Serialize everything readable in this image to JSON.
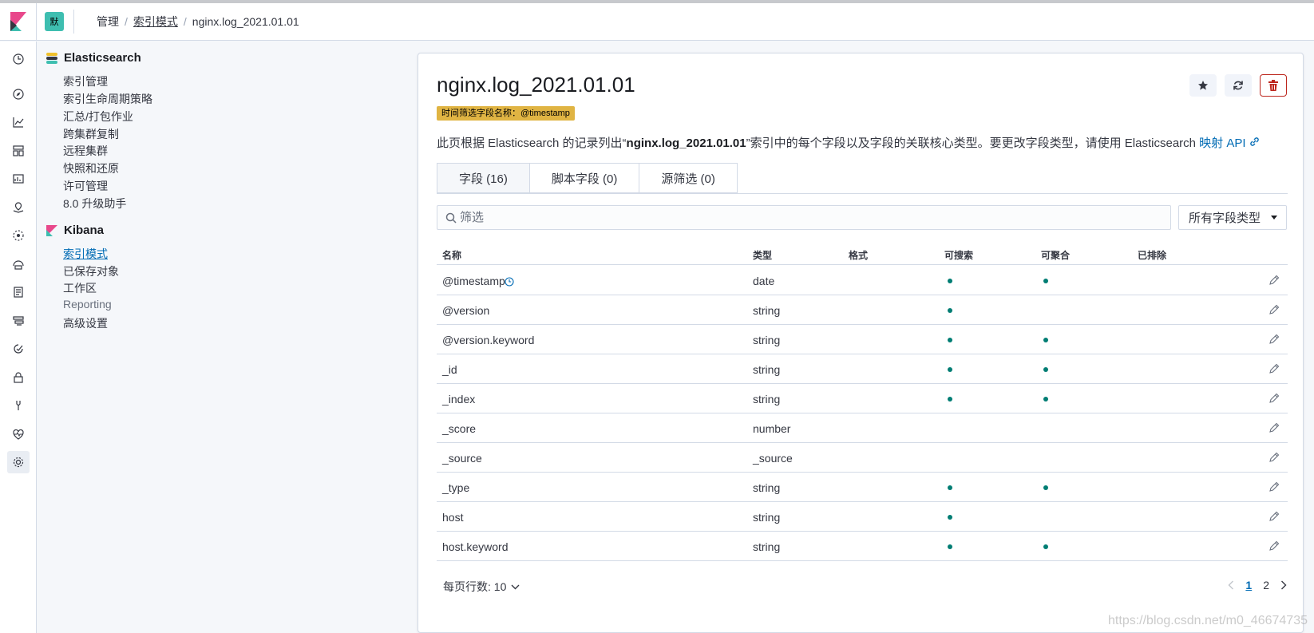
{
  "header": {
    "space_initial": "默",
    "breadcrumbs": [
      "管理",
      "索引模式",
      "nginx.log_2021.01.01"
    ]
  },
  "leftnav": {
    "icons": [
      "clock-icon",
      "compass-icon",
      "visualize-icon",
      "dashboard-icon",
      "canvas-icon",
      "maps-icon",
      "ml-icon",
      "infrastructure-icon",
      "logs-icon",
      "apm-icon",
      "uptime-icon",
      "siem-icon",
      "dev-tools-icon",
      "monitoring-icon",
      "management-icon"
    ]
  },
  "subnav": {
    "elasticsearch_title": "Elasticsearch",
    "elasticsearch_items": [
      "索引管理",
      "索引生命周期策略",
      "汇总/打包作业",
      "跨集群复制",
      "远程集群",
      "快照和还原",
      "许可管理",
      "8.0 升级助手"
    ],
    "kibana_title": "Kibana",
    "kibana_items": [
      "索引模式",
      "已保存对象",
      "工作区",
      "Reporting",
      "高级设置"
    ]
  },
  "page": {
    "title": "nginx.log_2021.01.01",
    "badge": "时间筛选字段名称：@timestamp",
    "desc_pre": "此页根据 Elasticsearch 的记录列出“",
    "desc_bold": "nginx.log_2021.01.01",
    "desc_post": "”索引中的每个字段以及字段的关联核心类型。要更改字段类型，请使用 Elasticsearch ",
    "desc_link": "映射 API",
    "tabs": [
      "字段 (16)",
      "脚本字段 (0)",
      "源筛选 (0)"
    ],
    "filter_placeholder": "筛选",
    "type_select": "所有字段类型"
  },
  "table": {
    "headers": [
      "名称",
      "类型",
      "格式",
      "可搜索",
      "可聚合",
      "已排除"
    ],
    "rows": [
      {
        "name": "@timestamp",
        "type": "date",
        "searchable": true,
        "aggregatable": true
      },
      {
        "name": "@version",
        "type": "string",
        "searchable": true,
        "aggregatable": false
      },
      {
        "name": "@version.keyword",
        "type": "string",
        "searchable": true,
        "aggregatable": true
      },
      {
        "name": "_id",
        "type": "string",
        "searchable": true,
        "aggregatable": true
      },
      {
        "name": "_index",
        "type": "string",
        "searchable": true,
        "aggregatable": true
      },
      {
        "name": "_score",
        "type": "number",
        "searchable": false,
        "aggregatable": false
      },
      {
        "name": "_source",
        "type": "_source",
        "searchable": false,
        "aggregatable": false
      },
      {
        "name": "_type",
        "type": "string",
        "searchable": true,
        "aggregatable": true
      },
      {
        "name": "host",
        "type": "string",
        "searchable": true,
        "aggregatable": false
      },
      {
        "name": "host.keyword",
        "type": "string",
        "searchable": true,
        "aggregatable": true
      }
    ]
  },
  "footer": {
    "rows_per_page": "每页行数: 10",
    "pages": [
      "1",
      "2"
    ],
    "current_page": "1"
  },
  "watermark": "https://blog.csdn.net/m0_46674735"
}
